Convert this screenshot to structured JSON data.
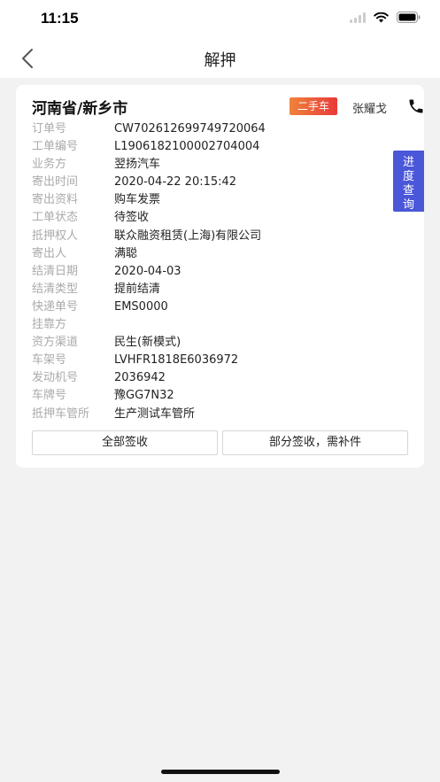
{
  "status_bar": {
    "time": "11:15",
    "icons": [
      "signal-icon",
      "wifi-icon",
      "battery-icon"
    ]
  },
  "nav": {
    "title": "解押",
    "back_icon": "chevron-left-icon"
  },
  "card": {
    "location": "河南省/新乡市",
    "tag": "二手车",
    "contact_name": "张耀戈",
    "phone_icon": "phone-icon",
    "fields": [
      {
        "label": "订单号",
        "value": "CW702612699749720064"
      },
      {
        "label": "工单编号",
        "value": "L1906182100002704004"
      },
      {
        "label": "业务方",
        "value": "翌扬汽车"
      },
      {
        "label": "寄出时间",
        "value": "2020-04-22 20:15:42"
      },
      {
        "label": "寄出资料",
        "value": "购车发票"
      },
      {
        "label": "工单状态",
        "value": "待签收"
      },
      {
        "label": "抵押权人",
        "value": "联众融资租赁(上海)有限公司"
      },
      {
        "label": "寄出人",
        "value": "满聪"
      },
      {
        "label": "结清日期",
        "value": "2020-04-03"
      },
      {
        "label": "结清类型",
        "value": "提前结清"
      },
      {
        "label": "快递单号",
        "value": "EMS0000"
      },
      {
        "label": "挂靠方",
        "value": ""
      },
      {
        "label": "资方渠道",
        "value": "民生(新模式)"
      },
      {
        "label": "车架号",
        "value": "LVHFR1818E6036972"
      },
      {
        "label": "发动机号",
        "value": "2036942"
      },
      {
        "label": "车牌号",
        "value": "豫GG7N32"
      },
      {
        "label": "抵押车管所",
        "value": "生产测试车管所"
      }
    ],
    "buttons": {
      "receive_all": "全部签收",
      "receive_partial": "部分签收，需补件"
    }
  },
  "progress_tab": {
    "chars": [
      "进",
      "度",
      "查",
      "询"
    ]
  },
  "colors": {
    "tag_gradient_start": "#f0823a",
    "tag_gradient_end": "#e83a3a",
    "progress_tab": "#4a57d8",
    "label_gray": "#aaaaaa",
    "background": "#f2f2f2"
  }
}
